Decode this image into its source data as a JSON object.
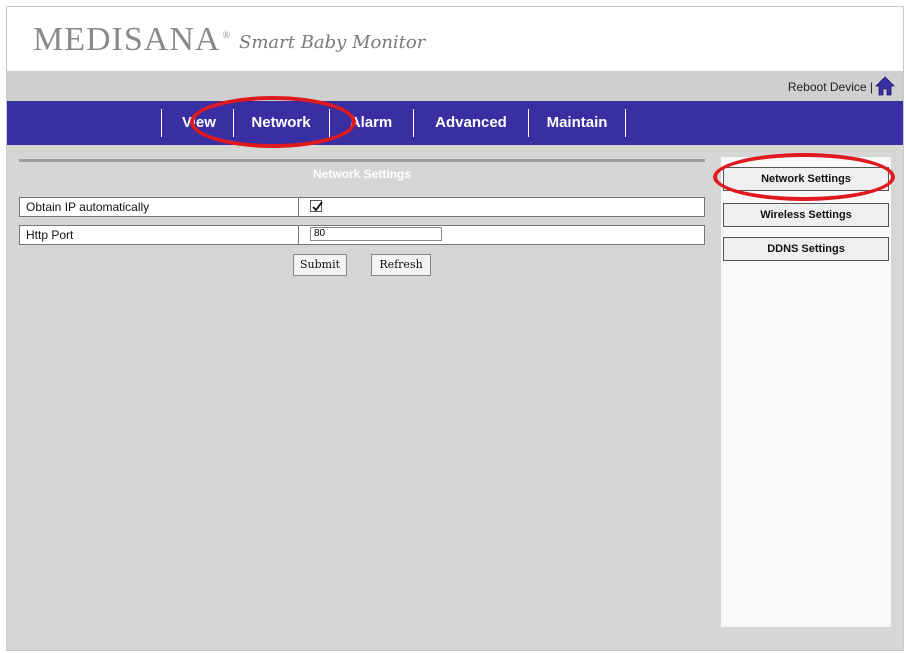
{
  "brand": {
    "name": "MEDISANA",
    "trademark": "®",
    "tagline": "Smart Baby Monitor"
  },
  "toolbar": {
    "reboot_label": "Reboot Device |",
    "home_icon": "home-icon"
  },
  "nav": {
    "items": [
      {
        "label": "View"
      },
      {
        "label": "Network"
      },
      {
        "label": "Alarm"
      },
      {
        "label": "Advanced"
      },
      {
        "label": "Maintain"
      }
    ]
  },
  "network_settings": {
    "title": "Network Settings",
    "rows": [
      {
        "label": "Obtain IP automatically",
        "checked": true
      },
      {
        "label": "Http Port",
        "value": "80"
      }
    ],
    "submit_label": "Submit",
    "refresh_label": "Refresh"
  },
  "side_menu": {
    "items": [
      {
        "label": "Network Settings"
      },
      {
        "label": "Wireless Settings"
      },
      {
        "label": "DDNS Settings"
      }
    ]
  },
  "colors": {
    "nav": "#3a2ea3",
    "highlight": "#e0191f",
    "background": "#d6d6d4"
  }
}
